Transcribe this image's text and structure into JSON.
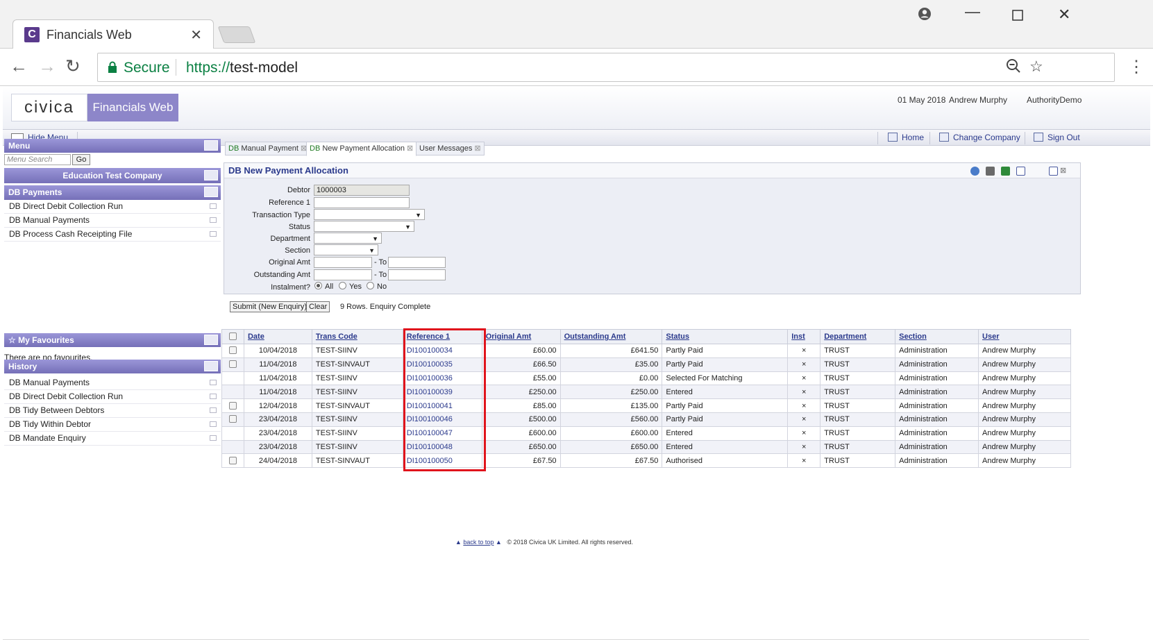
{
  "browser": {
    "tab_title": "Financials Web",
    "secure_label": "Secure",
    "url_scheme": "https://",
    "url_host": "test-model"
  },
  "app": {
    "logo_text": "civica",
    "product_name": "Financials Web",
    "date": "01 May 2018",
    "user": "Andrew Murphy",
    "authority": "AuthorityDemo",
    "hide_menu": "Hide Menu",
    "home": "Home",
    "change_company": "Change Company",
    "sign_out": "Sign Out"
  },
  "sidebar": {
    "menu_title": "Menu",
    "search_placeholder": "Menu Search",
    "go_label": "Go",
    "company": "Education Test Company",
    "section_title": "DB Payments",
    "items": [
      "DB Direct Debit Collection Run",
      "DB Manual Payments",
      "DB Process Cash Receipting File"
    ],
    "favourites_title": "My Favourites",
    "favourites_empty": "There are no favourites.",
    "history_title": "History",
    "history": [
      "DB Manual Payments",
      "DB Direct Debit Collection Run",
      "DB Tidy Between Debtors",
      "DB Tidy Within Debtor",
      "DB Mandate Enquiry"
    ]
  },
  "tabs": [
    {
      "prefix": "DB",
      "label": "Manual Payment"
    },
    {
      "prefix": "DB",
      "label": "New Payment Allocation"
    },
    {
      "prefix": "",
      "label": "User Messages"
    }
  ],
  "form": {
    "title": "DB New Payment Allocation",
    "labels": {
      "debtor": "Debtor",
      "reference1": "Reference 1",
      "transaction_type": "Transaction Type",
      "status": "Status",
      "department": "Department",
      "section": "Section",
      "original_amt": "Original Amt",
      "outstanding_amt": "Outstanding Amt",
      "instalment": "Instalment?",
      "to": "- To"
    },
    "debtor_value": "1000003",
    "radio": {
      "all": "All",
      "yes": "Yes",
      "no": "No"
    },
    "submit_label": "Submit (New Enquiry)",
    "clear_label": "Clear",
    "status_text": "9 Rows. Enquiry Complete"
  },
  "table": {
    "columns": [
      "Date",
      "Trans Code",
      "Reference 1",
      "Original Amt",
      "Outstanding Amt",
      "Status",
      "Inst",
      "Department",
      "Section",
      "User"
    ],
    "rows": [
      {
        "check": true,
        "date": "10/04/2018",
        "code": "TEST-SIINV",
        "ref": "DI100100034",
        "orig": "£60.00",
        "out": "£641.50",
        "status": "Partly Paid",
        "inst": "×",
        "dept": "TRUST",
        "section": "Administration",
        "user": "Andrew Murphy"
      },
      {
        "check": true,
        "date": "11/04/2018",
        "code": "TEST-SINVAUT",
        "ref": "DI100100035",
        "orig": "£66.50",
        "out": "£35.00",
        "status": "Partly Paid",
        "inst": "×",
        "dept": "TRUST",
        "section": "Administration",
        "user": "Andrew Murphy"
      },
      {
        "check": false,
        "date": "11/04/2018",
        "code": "TEST-SIINV",
        "ref": "DI100100036",
        "orig": "£55.00",
        "out": "£0.00",
        "status": "Selected For Matching",
        "inst": "×",
        "dept": "TRUST",
        "section": "Administration",
        "user": "Andrew Murphy"
      },
      {
        "check": false,
        "date": "11/04/2018",
        "code": "TEST-SIINV",
        "ref": "DI100100039",
        "orig": "£250.00",
        "out": "£250.00",
        "status": "Entered",
        "inst": "×",
        "dept": "TRUST",
        "section": "Administration",
        "user": "Andrew Murphy"
      },
      {
        "check": true,
        "date": "12/04/2018",
        "code": "TEST-SINVAUT",
        "ref": "DI100100041",
        "orig": "£85.00",
        "out": "£135.00",
        "status": "Partly Paid",
        "inst": "×",
        "dept": "TRUST",
        "section": "Administration",
        "user": "Andrew Murphy"
      },
      {
        "check": true,
        "date": "23/04/2018",
        "code": "TEST-SIINV",
        "ref": "DI100100046",
        "orig": "£500.00",
        "out": "£560.00",
        "status": "Partly Paid",
        "inst": "×",
        "dept": "TRUST",
        "section": "Administration",
        "user": "Andrew Murphy"
      },
      {
        "check": false,
        "date": "23/04/2018",
        "code": "TEST-SIINV",
        "ref": "DI100100047",
        "orig": "£600.00",
        "out": "£600.00",
        "status": "Entered",
        "inst": "×",
        "dept": "TRUST",
        "section": "Administration",
        "user": "Andrew Murphy"
      },
      {
        "check": false,
        "date": "23/04/2018",
        "code": "TEST-SIINV",
        "ref": "DI100100048",
        "orig": "£650.00",
        "out": "£650.00",
        "status": "Entered",
        "inst": "×",
        "dept": "TRUST",
        "section": "Administration",
        "user": "Andrew Murphy"
      },
      {
        "check": true,
        "date": "24/04/2018",
        "code": "TEST-SINVAUT",
        "ref": "DI100100050",
        "orig": "£67.50",
        "out": "£67.50",
        "status": "Authorised",
        "inst": "×",
        "dept": "TRUST",
        "section": "Administration",
        "user": "Andrew Murphy"
      }
    ]
  },
  "footer": {
    "back_to_top": "back to top",
    "copyright": "© 2018 Civica UK Limited. All rights reserved."
  },
  "colors": {
    "brand_purple": "#8d86c9",
    "link_blue": "#2b3a8c",
    "secure_green": "#0b8043",
    "highlight_red": "#e0141c"
  }
}
